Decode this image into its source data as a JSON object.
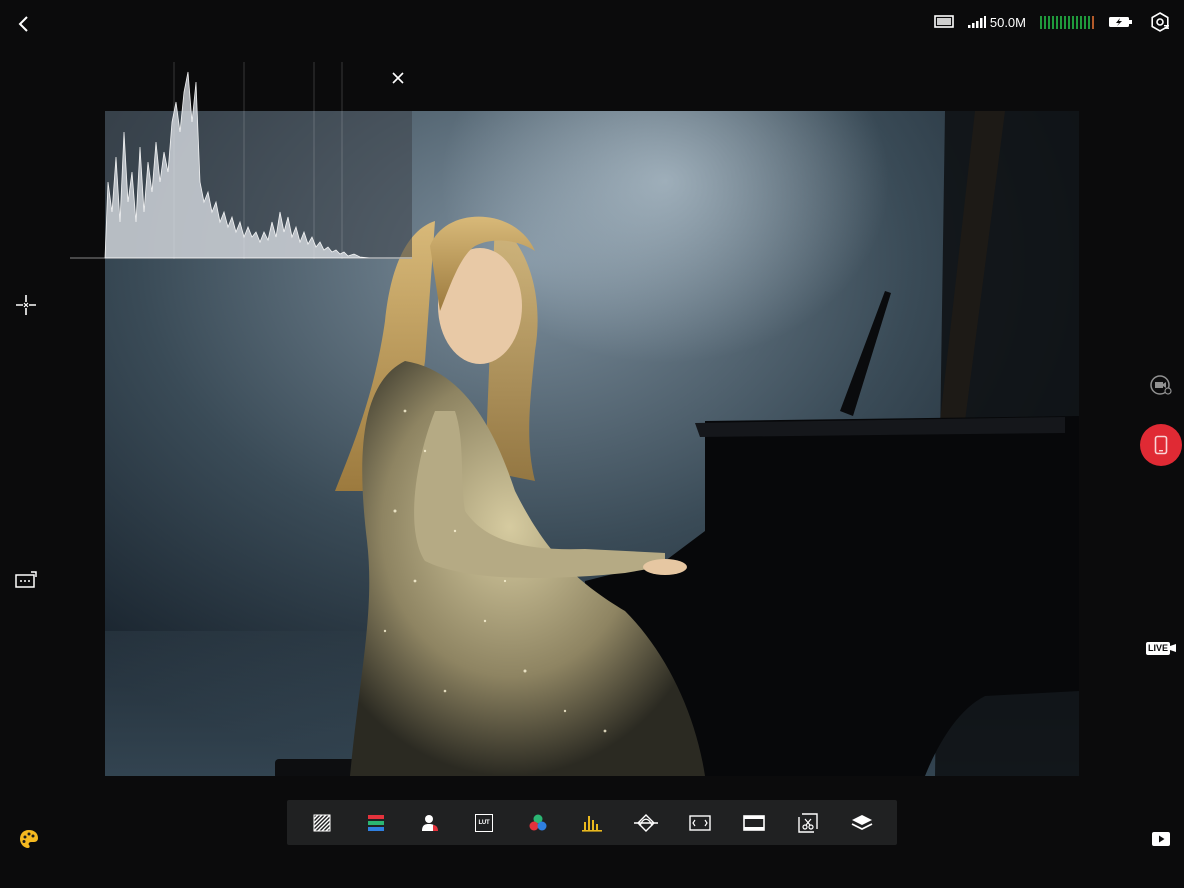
{
  "status": {
    "storage": "50.0M",
    "icons": [
      "display-icon",
      "signal-icon",
      "audio-level-icon",
      "battery-charging-icon",
      "settings-icon"
    ]
  },
  "colors": {
    "record": "#e02a34",
    "audio_level": "#1f9a3c",
    "waveform_yellow": "#e9b81e",
    "accent_red": "#e4323c",
    "accent_green": "#2bb673",
    "accent_blue": "#2f7fe0"
  },
  "left_icons": [
    "back-icon",
    "focus-crosshair-icon",
    "frame-guide-icon",
    "palette-icon"
  ],
  "right_icons": [
    "camera-switch-icon",
    "record-phone-icon",
    "live-icon",
    "playback-icon"
  ],
  "right_labels": {
    "live": "LIVE"
  },
  "toolbar": {
    "items": [
      {
        "name": "zebra-tool",
        "icon": "zebra-icon"
      },
      {
        "name": "false-color-tool",
        "icon": "false-color-icon"
      },
      {
        "name": "skin-tone-tool",
        "icon": "skin-tone-icon"
      },
      {
        "name": "lut-tool",
        "icon": "lut-icon",
        "label": "LUT"
      },
      {
        "name": "rgb-parade-tool",
        "icon": "rgb-icon"
      },
      {
        "name": "waveform-tool",
        "icon": "waveform-icon"
      },
      {
        "name": "vectorscope-tool",
        "icon": "vectorscope-icon"
      },
      {
        "name": "aspect-frame-tool",
        "icon": "aspect-icon"
      },
      {
        "name": "anamorphic-tool",
        "icon": "anamorphic-icon"
      },
      {
        "name": "frame-compare-tool",
        "icon": "compare-icon"
      },
      {
        "name": "layers-tool",
        "icon": "layers-icon"
      }
    ]
  }
}
